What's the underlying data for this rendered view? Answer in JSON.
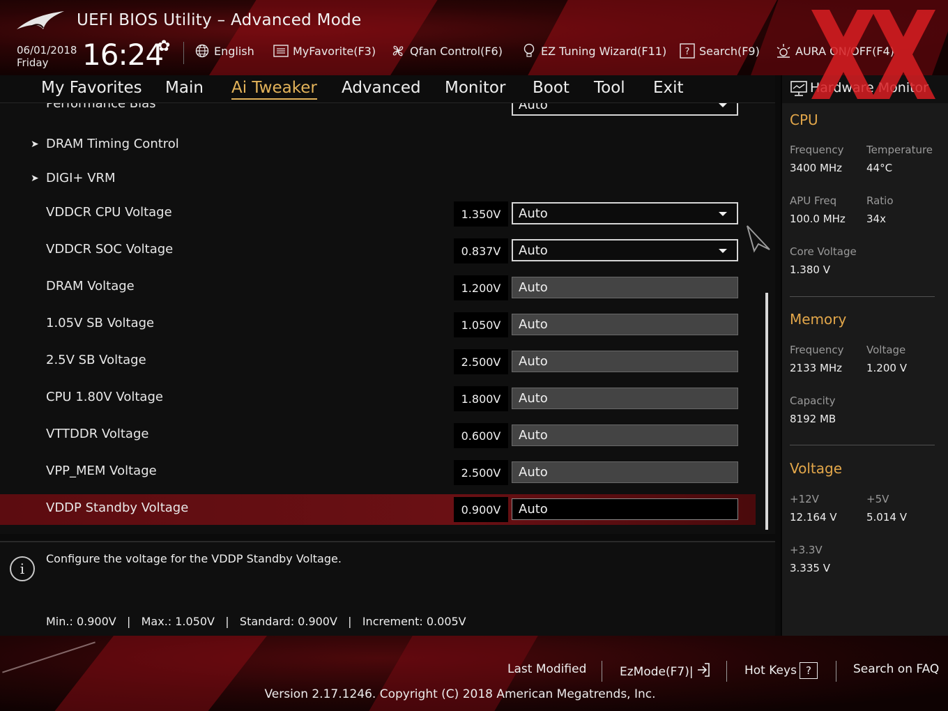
{
  "header": {
    "title": "UEFI BIOS Utility – Advanced Mode",
    "date": "06/01/2018",
    "day": "Friday",
    "time": "16:24",
    "tools": {
      "language": "English",
      "favorite": "MyFavorite(F3)",
      "qfan": "Qfan Control(F6)",
      "ez_tuning": "EZ Tuning Wizard(F11)",
      "search": "Search(F9)",
      "aura": "AURA ON/OFF(F4)"
    }
  },
  "nav": {
    "tabs": [
      {
        "label": "My Favorites"
      },
      {
        "label": "Main"
      },
      {
        "label": "Ai Tweaker"
      },
      {
        "label": "Advanced"
      },
      {
        "label": "Monitor"
      },
      {
        "label": "Boot"
      },
      {
        "label": "Tool"
      },
      {
        "label": "Exit"
      }
    ],
    "active": "Ai Tweaker"
  },
  "main": {
    "partial_row": {
      "label": "Performance Bias",
      "value": "Auto"
    },
    "submenus": [
      {
        "label": "DRAM Timing Control"
      },
      {
        "label": "DIGI+ VRM"
      }
    ],
    "rows": [
      {
        "label": "VDDCR CPU Voltage",
        "current": "1.350V",
        "value": "Auto",
        "kind": "select"
      },
      {
        "label": "VDDCR SOC Voltage",
        "current": "0.837V",
        "value": "Auto",
        "kind": "select"
      },
      {
        "label": "DRAM Voltage",
        "current": "1.200V",
        "value": "Auto",
        "kind": "input"
      },
      {
        "label": "1.05V SB Voltage",
        "current": "1.050V",
        "value": "Auto",
        "kind": "input"
      },
      {
        "label": "2.5V SB Voltage",
        "current": "2.500V",
        "value": "Auto",
        "kind": "input"
      },
      {
        "label": "CPU 1.80V Voltage",
        "current": "1.800V",
        "value": "Auto",
        "kind": "input"
      },
      {
        "label": "VTTDDR Voltage",
        "current": "0.600V",
        "value": "Auto",
        "kind": "input"
      },
      {
        "label": "VPP_MEM Voltage",
        "current": "2.500V",
        "value": "Auto",
        "kind": "input"
      },
      {
        "label": "VDDP Standby Voltage",
        "current": "0.900V",
        "value": "Auto",
        "kind": "input",
        "selected": true
      }
    ]
  },
  "help": {
    "description": "Configure the voltage for the VDDP Standby Voltage.",
    "limits": "Min.: 0.900V   |   Max.: 1.050V   |   Standard: 0.900V   |   Increment: 0.005V"
  },
  "hardware_monitor": {
    "title": "Hardware Monitor",
    "cpu": {
      "section": "CPU",
      "frequency_label": "Frequency",
      "frequency": "3400 MHz",
      "temperature_label": "Temperature",
      "temperature": "44°C",
      "apu_label": "APU Freq",
      "apu": "100.0 MHz",
      "ratio_label": "Ratio",
      "ratio": "34x",
      "core_voltage_label": "Core Voltage",
      "core_voltage": "1.380 V"
    },
    "memory": {
      "section": "Memory",
      "frequency_label": "Frequency",
      "frequency": "2133 MHz",
      "voltage_label": "Voltage",
      "voltage": "1.200 V",
      "capacity_label": "Capacity",
      "capacity": "8192 MB"
    },
    "voltage": {
      "section": "Voltage",
      "v12_label": "+12V",
      "v12": "12.164 V",
      "v5_label": "+5V",
      "v5": "5.014 V",
      "v33_label": "+3.3V",
      "v33": "3.335 V"
    }
  },
  "footer": {
    "last_modified": "Last Modified",
    "ezmode": "EzMode(F7)|",
    "hotkeys": "Hot Keys",
    "hotkeys_key": "?",
    "faq": "Search on FAQ",
    "version": "Version 2.17.1246. Copyright (C) 2018 American Megatrends, Inc."
  },
  "colors": {
    "accent": "#e3b35a",
    "selected_row": "#6a1014",
    "section_heading": "#e3a74a"
  }
}
